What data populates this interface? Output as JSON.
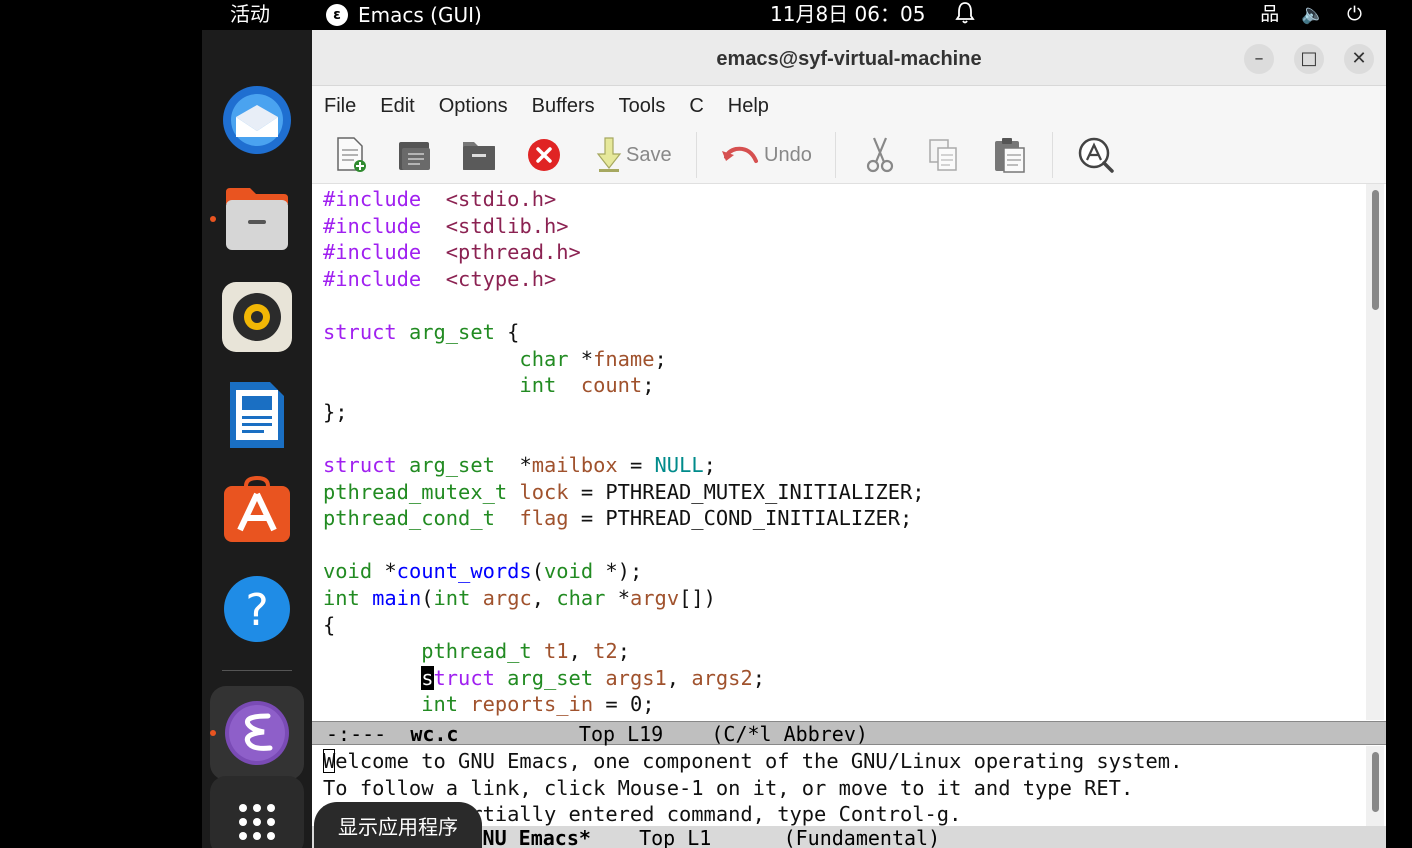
{
  "topbar": {
    "activities": "活动",
    "app_icon_glyph": "ε",
    "app_name": "Emacs (GUI)",
    "clock": "11月8日  06：05",
    "bell_icon": "bell-icon",
    "network_glyph": "品",
    "volume_glyph": "🔈",
    "power_glyph": "⏻"
  },
  "dock": {
    "apps": [
      "thunderbird",
      "files",
      "rhythmbox",
      "libreoffice-writer",
      "app-center",
      "help",
      "emacs"
    ],
    "help_glyph": "?",
    "show_apps_tooltip": "显示应用程序"
  },
  "window": {
    "title": "emacs@syf-virtual-machine",
    "minimize_glyph": "–",
    "maximize_glyph": "□",
    "close_glyph": "✕"
  },
  "menubar": {
    "items": [
      "File",
      "Edit",
      "Options",
      "Buffers",
      "Tools",
      "C",
      "Help"
    ]
  },
  "toolbar": {
    "save_label": "Save",
    "undo_label": "Undo"
  },
  "editor": {
    "code": {
      "l1_kw": "#include",
      "l1_rest": "<stdio.h>",
      "l2_kw": "#include",
      "l2_rest": "<stdlib.h>",
      "l3_kw": "#include",
      "l3_rest": "<pthread.h>",
      "l4_kw": "#include",
      "l4_rest": "<ctype.h>",
      "s_kw": "struct",
      "s_ty": "arg_set",
      "s_brace": " {",
      "c_ty": "char",
      "c_star": " *",
      "c_vr": "fname",
      "c_end": ";",
      "i_ty": "int",
      "i_sp": "  ",
      "i_vr": "count",
      "i_end": ";",
      "close": "};",
      "m_kw": "struct",
      "m_ty": "arg_set",
      "m_star": "  *",
      "m_vr": "mailbox",
      "m_eq": " = ",
      "m_cs": "NULL",
      "m_end": ";",
      "lk_ty": "pthread_mutex_t",
      "lk_vr": "lock",
      "lk_rest": " = PTHREAD_MUTEX_INITIALIZER;",
      "fl_ty": "pthread_cond_t",
      "fl_sp": "  ",
      "fl_vr": "flag",
      "fl_rest": " = PTHREAD_COND_INITIALIZER;",
      "cw_ty": "void",
      "cw_star": " *",
      "cw_fn": "count_words",
      "cw_p": "(",
      "cw_ty2": "void",
      "cw_end": " *);",
      "mn_ty": "int",
      "mn_fn": "main",
      "mn_p": "(",
      "mn_ty2": "int",
      "mn_vr": "argc",
      "mn_comma": ", ",
      "mn_ty3": "char",
      "mn_star": " *",
      "mn_vr2": "argv",
      "mn_end": "[])",
      "ob": "{",
      "t_ty": "pthread_t",
      "t_vr": "t1",
      "t_comma": ", ",
      "t_vr2": "t2",
      "t_end": ";",
      "a_cursor": "s",
      "a_kw": "truct",
      "a_ty": "arg_set",
      "a_vr": "args1",
      "a_comma": ", ",
      "a_vr2": "args2",
      "a_end": ";",
      "r_ty": "int",
      "r_vr": "reports_in",
      "r_end": " = 0;"
    }
  },
  "modeline1": {
    "status": "-:---",
    "buffer": "wc.c",
    "position": "Top L19",
    "mode": "(C/*l Abbrev)"
  },
  "echo": {
    "cursor_char": "W",
    "line1_rest": "elcome to GNU Emacs, one component of the GNU/Linux operating system.",
    "line2": "To follow a link, click Mouse-1 on it, or move to it and type RET.",
    "line3": "To quit a partially entered command, type Control-g."
  },
  "modeline2": {
    "buffer": "*GNU Emacs*",
    "position": "Top L1",
    "mode": "(Fundamental)"
  },
  "colors": {
    "keyword": "#a020f0",
    "type": "#228b22",
    "function": "#0000ff",
    "variable": "#a0522d",
    "string": "#8b2252",
    "constant": "#008b8b",
    "accent": "#e95420"
  }
}
